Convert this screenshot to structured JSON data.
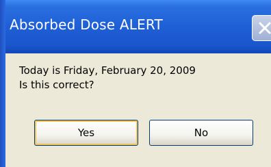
{
  "dialog": {
    "title": "Absorbed Dose ALERT",
    "message_line1": "Today is Friday, February 20, 2009",
    "message_line2": "Is this correct?",
    "yes_label": "Yes",
    "no_label": "No",
    "close_icon": "close-icon"
  },
  "colors": {
    "title_bar": "#1f5fd6",
    "client_background": "#ece9d8",
    "button_border": "#003c74",
    "focus_highlight": "#f4c25a"
  }
}
